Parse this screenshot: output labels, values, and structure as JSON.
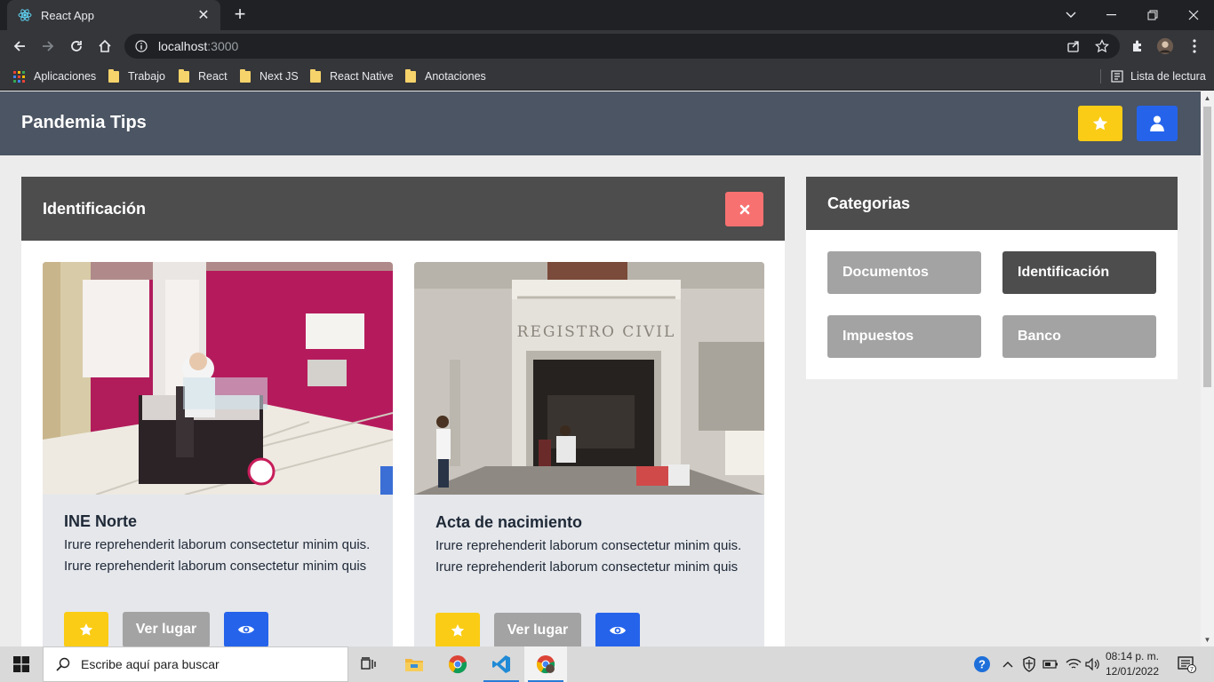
{
  "browser": {
    "tab_title": "React App",
    "url_host": "localhost",
    "url_port": ":3000",
    "bookmarks": [
      "Aplicaciones",
      "Trabajo",
      "React",
      "Next JS",
      "React Native",
      "Anotaciones"
    ],
    "reading_list": "Lista de lectura"
  },
  "app": {
    "brand": "Pandemia Tips",
    "panel_title": "Identificación",
    "cards": [
      {
        "title": "INE Norte",
        "description": "Irure reprehenderit laborum consectetur minim quis. Irure reprehenderit laborum consectetur minim quis",
        "place_button": "Ver lugar"
      },
      {
        "title": "Acta de nacimiento",
        "description": "Irure reprehenderit laborum consectetur minim quis. Irure reprehenderit laborum consectetur minim quis",
        "place_button": "Ver lugar",
        "image_sign": "REGISTRO CIVIL"
      }
    ],
    "sidebar": {
      "title": "Categorias",
      "categories": [
        "Documentos",
        "Identificación",
        "Impuestos",
        "Banco"
      ],
      "active": "Identificación"
    },
    "colors": {
      "navbar": "#4b5563",
      "panel_header": "#4d4d4d",
      "favorite": "#facc15",
      "primary": "#2563eb",
      "danger": "#f87171",
      "neutral_button": "#a3a3a3"
    }
  },
  "taskbar": {
    "search_placeholder": "Escribe aquí para buscar",
    "time": "08:14 p. m.",
    "date": "12/01/2022",
    "notifications": "7"
  }
}
